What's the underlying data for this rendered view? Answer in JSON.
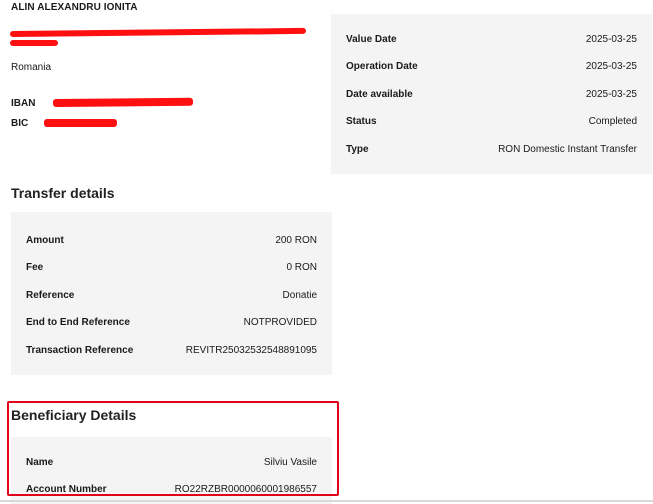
{
  "account": {
    "holder_name": "ALIN ALEXANDRU IONITA",
    "country": "Romania",
    "iban_label": "IBAN",
    "bic_label": "BIC"
  },
  "status_panel": {
    "rows": [
      {
        "label": "Value Date",
        "value": "2025-03-25"
      },
      {
        "label": "Operation Date",
        "value": "2025-03-25"
      },
      {
        "label": "Date available",
        "value": "2025-03-25"
      },
      {
        "label": "Status",
        "value": "Completed"
      },
      {
        "label": "Type",
        "value": "RON Domestic Instant Transfer"
      }
    ]
  },
  "transfer": {
    "title": "Transfer details",
    "rows": [
      {
        "label": "Amount",
        "value": "200 RON"
      },
      {
        "label": "Fee",
        "value": "0 RON"
      },
      {
        "label": "Reference",
        "value": "Donatie"
      },
      {
        "label": "End to End Reference",
        "value": "NOTPROVIDED"
      },
      {
        "label": "Transaction Reference",
        "value": "REVITR25032532548891095"
      }
    ]
  },
  "beneficiary": {
    "title": "Beneficiary Details",
    "rows": [
      {
        "label": "Name",
        "value": "Silviu Vasile"
      },
      {
        "label": "Account Number",
        "value": "RO22RZBR0000060001986557"
      }
    ]
  },
  "colors": {
    "panel_bg": "#f4f4f4",
    "redaction": "#ff1010",
    "highlight_border": "#e3001b"
  }
}
